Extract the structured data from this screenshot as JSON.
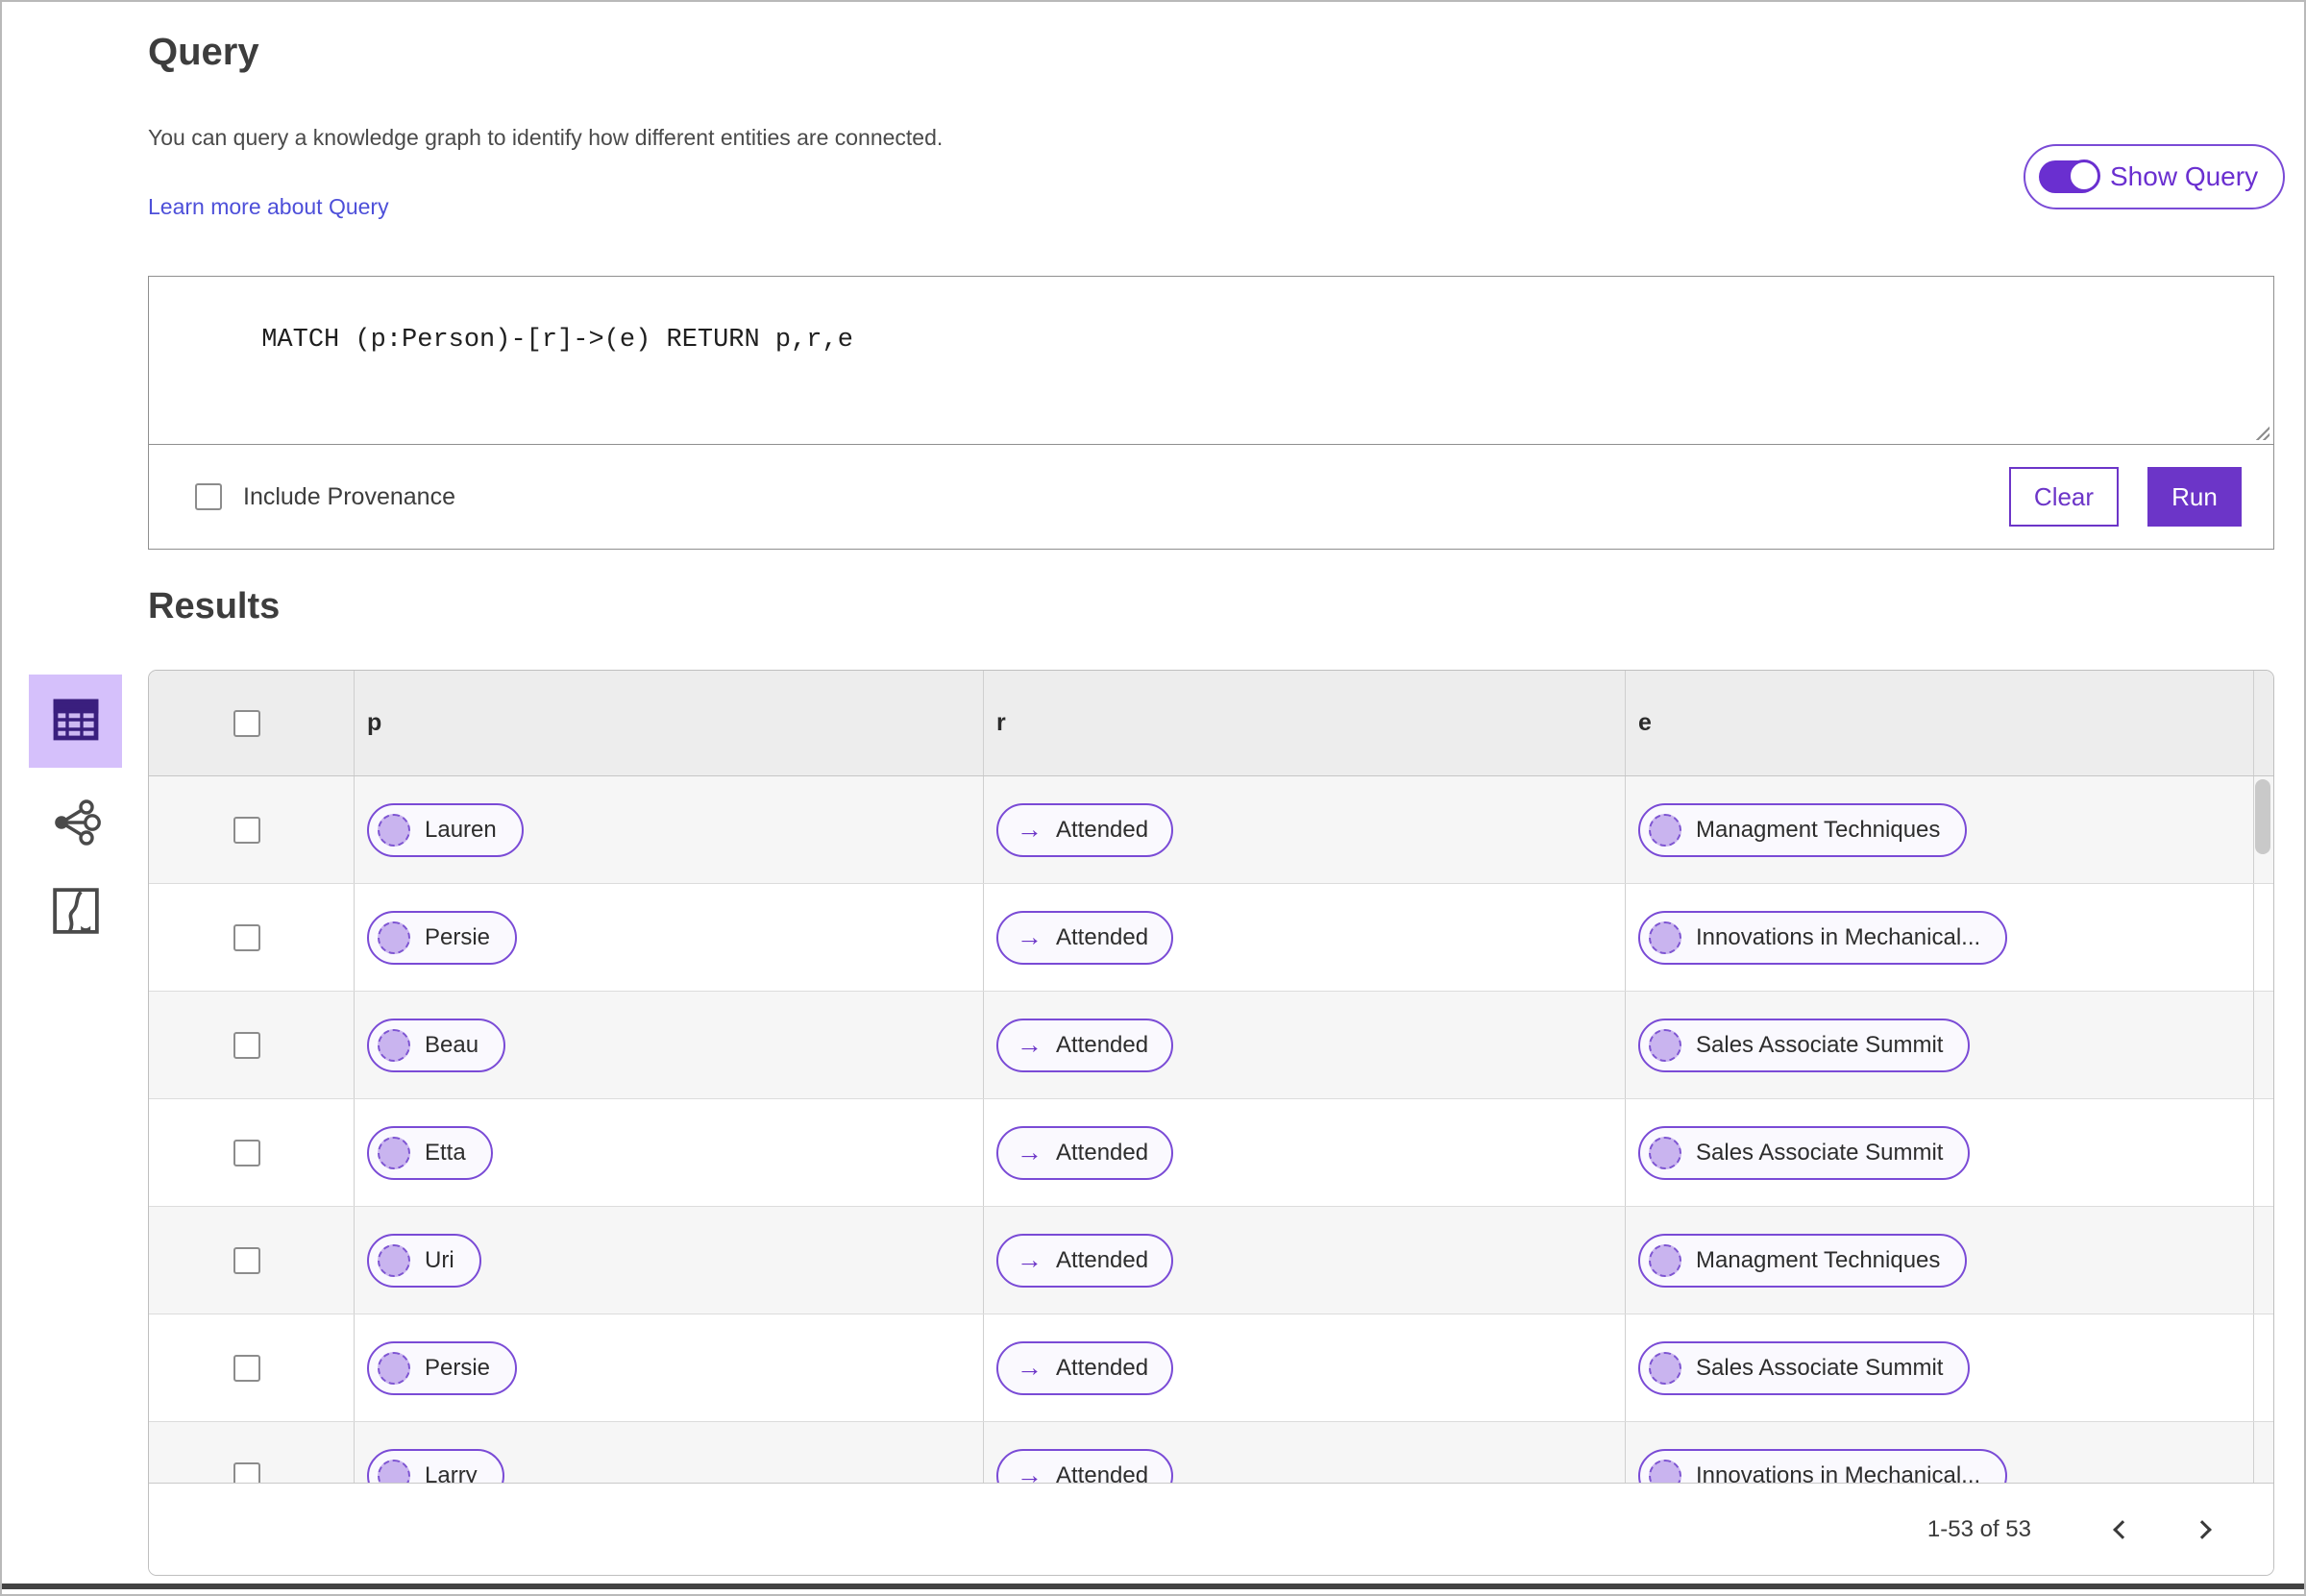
{
  "colors": {
    "accent": "#6C35C8",
    "pill_border": "#7A4BD6",
    "pill_background": "#FAF9FE",
    "node_circle_fill": "#C9B4EF",
    "selected_view_background": "#D5C0FB",
    "selected_view_icon": "#3A1F7E",
    "link": "#4D4FD9",
    "table_header_background": "#EDEDED",
    "row_stripe": "#F6F6F6"
  },
  "query": {
    "title": "Query",
    "description": "You can query a knowledge graph to identify how different entities are connected.",
    "learn_more_label": "Learn more about Query",
    "show_query": {
      "label": "Show Query",
      "state": "on"
    },
    "editor_text": "MATCH (p:Person)-[r]->(e) RETURN p,r,e",
    "include_provenance": {
      "label": "Include Provenance",
      "checked": false
    },
    "clear_label": "Clear",
    "run_label": "Run"
  },
  "results": {
    "title": "Results",
    "view_switcher": [
      {
        "name": "table-view",
        "icon": "table-icon",
        "selected": true
      },
      {
        "name": "network-view",
        "icon": "network-graph-icon",
        "selected": false
      },
      {
        "name": "map-view",
        "icon": "map-icon",
        "selected": false
      }
    ],
    "table": {
      "columns": [
        "p",
        "r",
        "e"
      ],
      "relation_arrow": "→",
      "rows": [
        {
          "p": "Lauren",
          "r": "Attended",
          "e": "Managment Techniques"
        },
        {
          "p": "Persie",
          "r": "Attended",
          "e": "Innovations in Mechanical..."
        },
        {
          "p": "Beau",
          "r": "Attended",
          "e": "Sales Associate Summit"
        },
        {
          "p": "Etta",
          "r": "Attended",
          "e": "Sales Associate Summit"
        },
        {
          "p": "Uri",
          "r": "Attended",
          "e": "Managment Techniques"
        },
        {
          "p": "Persie",
          "r": "Attended",
          "e": "Sales Associate Summit"
        },
        {
          "p": "Larry",
          "r": "Attended",
          "e": "Innovations in Mechanical..."
        }
      ]
    },
    "pagination": {
      "range_text": "1-53 of 53",
      "prev_icon": "chevron-left",
      "next_icon": "chevron-right"
    }
  }
}
